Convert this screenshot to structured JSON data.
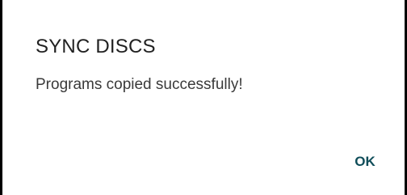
{
  "dialog": {
    "title": "SYNC DISCS",
    "message": "Programs copied successfully!",
    "ok_label": "OK"
  },
  "colors": {
    "title_text": "#212121",
    "message_text": "#3a3a3a",
    "button_text": "#0f4d59",
    "background": "#ffffff"
  }
}
